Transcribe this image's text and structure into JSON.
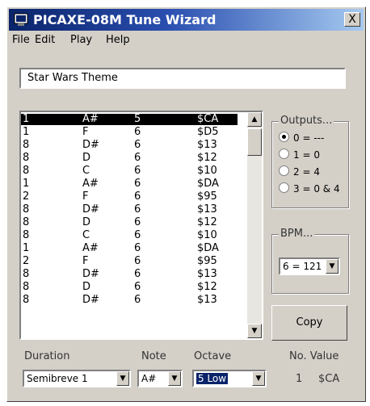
{
  "window": {
    "title": "PICAXE-08M Tune Wizard",
    "close_label": "X"
  },
  "menu": [
    "File",
    "Edit",
    "Play",
    "Help"
  ],
  "tune_name": "Star Wars Theme",
  "notes": [
    [
      "1",
      "A#",
      "5",
      "$CA"
    ],
    [
      "1",
      "F",
      "6",
      "$D5"
    ],
    [
      "8",
      "D#",
      "6",
      "$13"
    ],
    [
      "8",
      "D",
      "6",
      "$12"
    ],
    [
      "8",
      "C",
      "6",
      "$10"
    ],
    [
      "1",
      "A#",
      "6",
      "$DA"
    ],
    [
      "2",
      "F",
      "6",
      "$95"
    ],
    [
      "8",
      "D#",
      "6",
      "$13"
    ],
    [
      "8",
      "D",
      "6",
      "$12"
    ],
    [
      "8",
      "C",
      "6",
      "$10"
    ],
    [
      "1",
      "A#",
      "6",
      "$DA"
    ],
    [
      "2",
      "F",
      "6",
      "$95"
    ],
    [
      "8",
      "D#",
      "6",
      "$13"
    ],
    [
      "8",
      "D",
      "6",
      "$12"
    ],
    [
      "8",
      "D#",
      "6",
      "$13"
    ]
  ],
  "selected_row": 0,
  "outputs": {
    "title": "Outputs...",
    "options": [
      "0 = ---",
      "1 = 0",
      "2 = 4",
      "3 = 0 & 4"
    ],
    "selected": 0
  },
  "bpm": {
    "title": "BPM...",
    "value": "6 = 121"
  },
  "copy_label": "Copy",
  "duration": {
    "label": "Duration",
    "value": "Semibreve 1"
  },
  "note": {
    "label": "Note",
    "value": "A#"
  },
  "octave": {
    "label": "Octave",
    "value": "5 Low"
  },
  "no_value": {
    "label": "No. Value",
    "number": "1",
    "value": "$CA"
  },
  "colors": {
    "title_start": "#0a246a",
    "title_end": "#a6caf0",
    "face": "#d4d0c8",
    "highlight": "#0a246a"
  }
}
